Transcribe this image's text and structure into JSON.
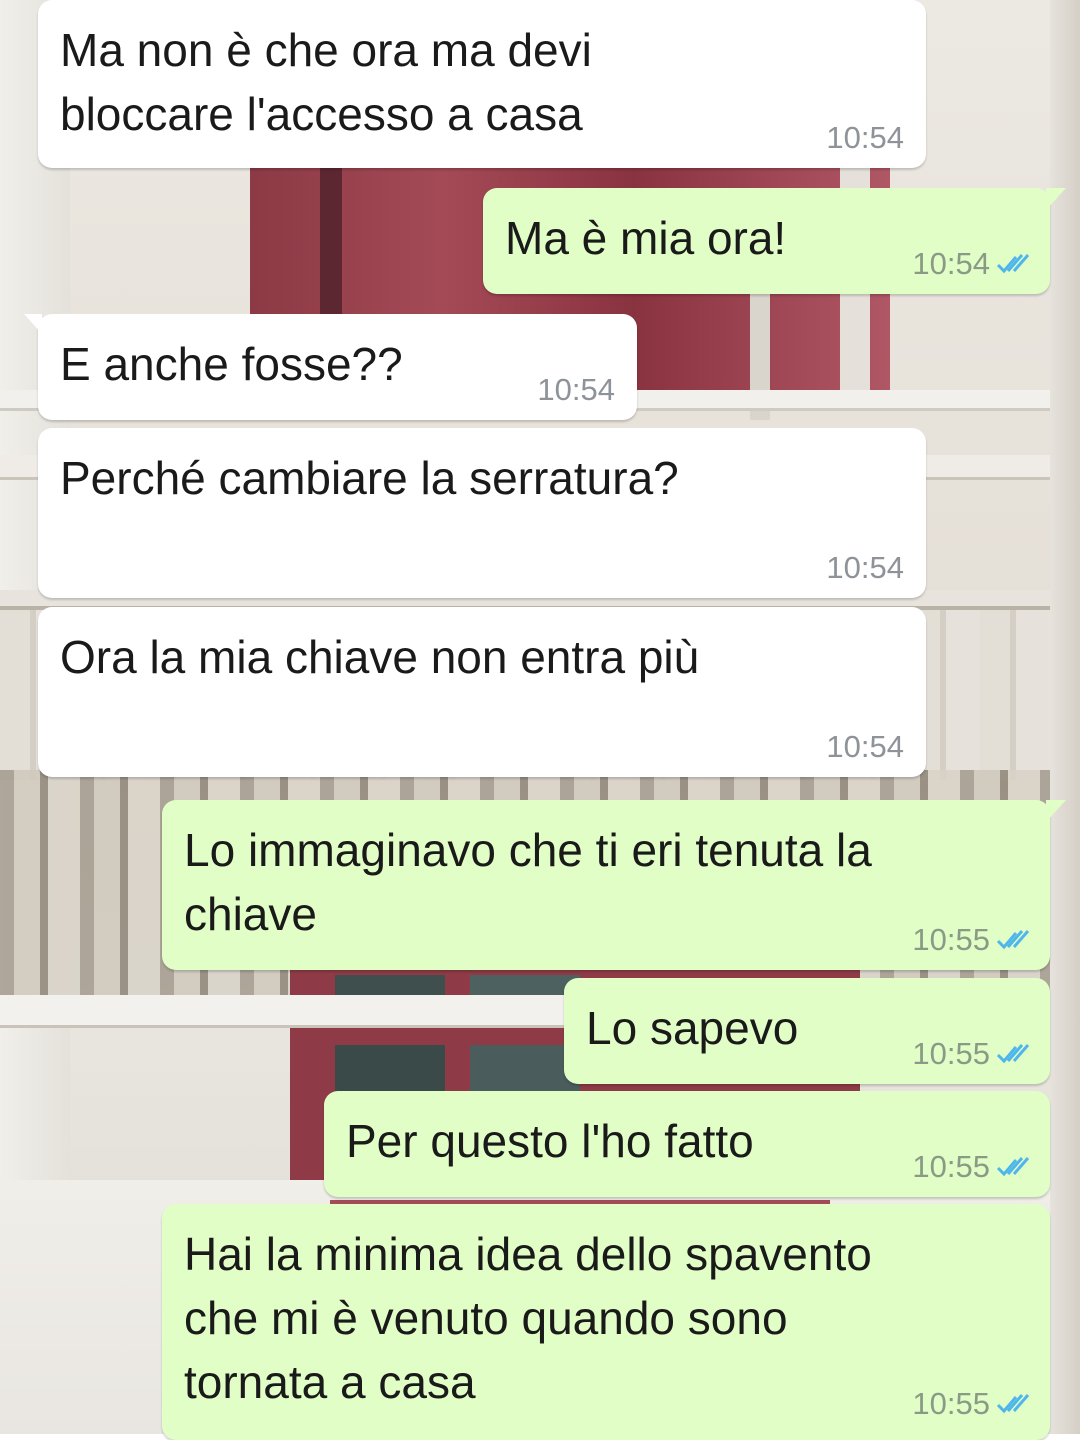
{
  "messages": [
    {
      "direction": "in",
      "text": "Ma non è che ora ma devi\nbloccare l'accesso a casa",
      "time": "10:54"
    },
    {
      "direction": "out",
      "text": "Ma è mia ora!",
      "time": "10:54",
      "status": "read"
    },
    {
      "direction": "in",
      "text": "E anche fosse??",
      "time": "10:54"
    },
    {
      "direction": "in",
      "text": "Perché cambiare la serratura?",
      "time": "10:54"
    },
    {
      "direction": "in",
      "text": "Ora la mia chiave non entra più",
      "time": "10:54"
    },
    {
      "direction": "out",
      "text": "Lo immaginavo che ti eri tenuta la\nchiave",
      "time": "10:55",
      "status": "read"
    },
    {
      "direction": "out",
      "text": "Lo sapevo",
      "time": "10:55",
      "status": "read"
    },
    {
      "direction": "out",
      "text": "Per questo l'ho fatto",
      "time": "10:55",
      "status": "read"
    },
    {
      "direction": "out",
      "text": "Hai la minima idea dello spavento\nche mi è venuto quando sono\ntornata a casa",
      "time": "10:55",
      "status": "read"
    }
  ],
  "icons": {
    "read_receipt": "double-check-icon"
  },
  "colors": {
    "incoming_bubble": "#ffffff",
    "outgoing_bubble": "#e1fec6",
    "read_tick": "#4fb6ec",
    "timestamp": "#8e9399"
  }
}
